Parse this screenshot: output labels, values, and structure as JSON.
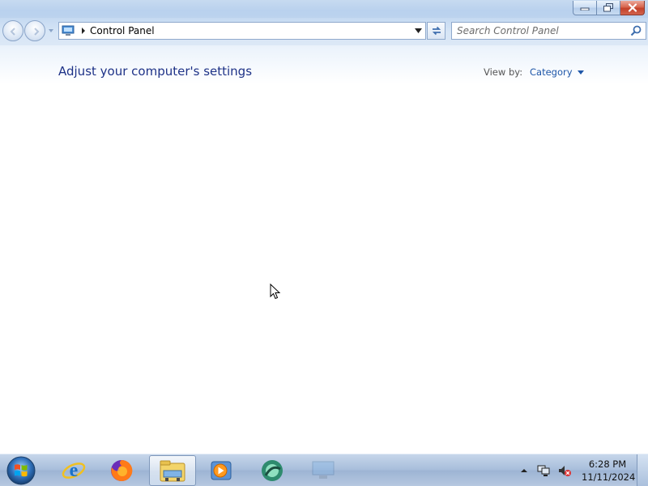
{
  "window": {
    "caption": {
      "minimize": "minimize",
      "maximize": "restore",
      "close": "close"
    }
  },
  "nav": {
    "breadcrumb": "Control Panel",
    "search_placeholder": "Search Control Panel"
  },
  "content": {
    "title": "Adjust your computer's settings",
    "view_by_label": "View by:",
    "view_by_value": "Category"
  },
  "taskbar": {
    "items": [
      {
        "icon": "internet-explorer-icon"
      },
      {
        "icon": "firefox-icon"
      },
      {
        "icon": "windows-explorer-icon",
        "active": true
      },
      {
        "icon": "media-player-icon"
      },
      {
        "icon": "app-icon"
      },
      {
        "icon": "control-panel-icon"
      }
    ],
    "clock": {
      "time": "6:28 PM",
      "date": "11/11/2024"
    }
  },
  "colors": {
    "title_blue": "#1e3287",
    "link_blue": "#1e56a8",
    "taskbar": "#a8bedb"
  }
}
